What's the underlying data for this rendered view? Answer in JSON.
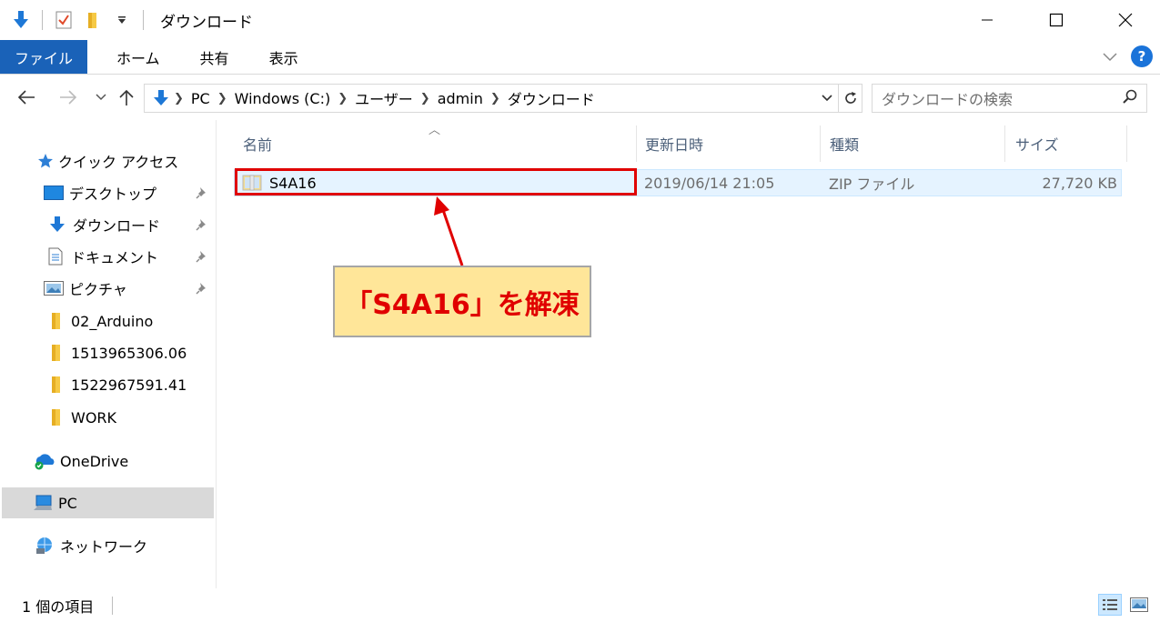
{
  "window": {
    "title": "ダウンロード"
  },
  "ribbon": {
    "tabs": [
      "ファイル",
      "ホーム",
      "共有",
      "表示"
    ],
    "help": "?"
  },
  "address": {
    "crumbs": [
      "PC",
      "Windows (C:)",
      "ユーザー",
      "admin",
      "ダウンロード"
    ],
    "search_placeholder": "ダウンロードの検索"
  },
  "navpane": {
    "quick_access": "クイック アクセス",
    "pinned": [
      "デスクトップ",
      "ダウンロード",
      "ドキュメント",
      "ピクチャ"
    ],
    "folders": [
      "02_Arduino",
      "1513965306.06",
      "1522967591.41",
      "WORK"
    ],
    "onedrive": "OneDrive",
    "pc": "PC",
    "network": "ネットワーク"
  },
  "columns": {
    "name": "名前",
    "date": "更新日時",
    "type": "種類",
    "size": "サイズ"
  },
  "files": [
    {
      "name": "S4A16",
      "date": "2019/06/14 21:05",
      "type": "ZIP ファイル",
      "size": "27,720 KB"
    }
  ],
  "callout": {
    "text": "「S4A16」を解凍",
    "color": "#e00000",
    "background": "#ffe699"
  },
  "status": {
    "count": "1 個の項目"
  },
  "colors": {
    "accent": "#1a62b8",
    "selection": "#e5f3ff",
    "highlight_border": "#e00000"
  }
}
